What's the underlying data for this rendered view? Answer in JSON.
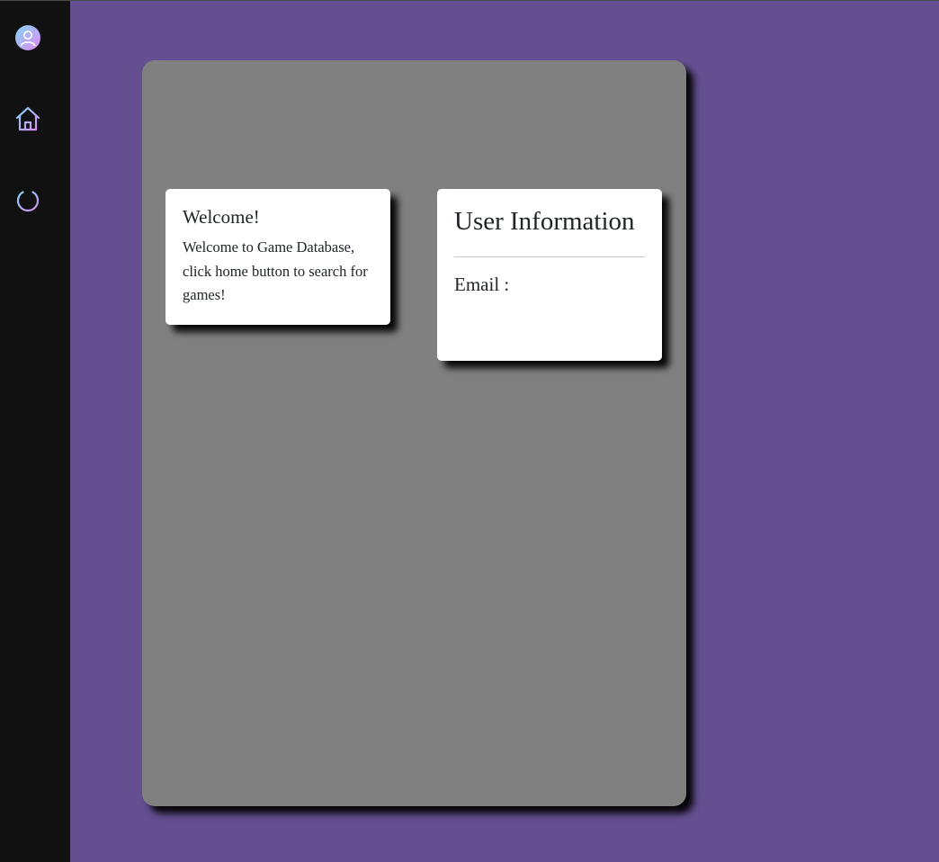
{
  "sidebar": {
    "items": [
      {
        "icon": "user-avatar-icon"
      },
      {
        "icon": "home-icon"
      },
      {
        "icon": "power-icon"
      }
    ]
  },
  "welcome_card": {
    "title": "Welcome!",
    "text": "Welcome to Game Database, click home button to search for games!"
  },
  "user_card": {
    "title": "User Information",
    "email_label": "Email :",
    "email_value": ""
  },
  "colors": {
    "background": "#644f91",
    "sidebar": "#111111",
    "panel": "#808080",
    "card": "#ffffff",
    "icon_gradient_start": "#7fd4f5",
    "icon_gradient_end": "#d98cf0"
  }
}
